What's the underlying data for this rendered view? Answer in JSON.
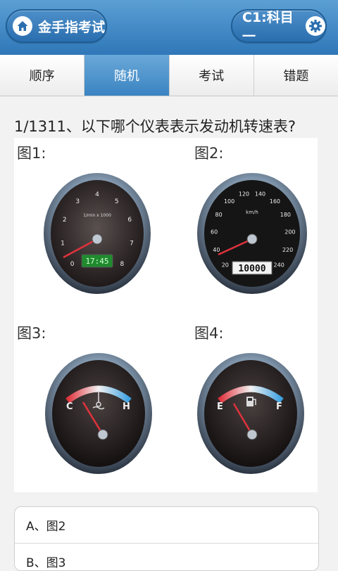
{
  "header": {
    "app_title": "金手指考试",
    "subject": "C1:科目一",
    "home_icon": "home-icon",
    "settings_icon": "gear-icon"
  },
  "tabs": [
    {
      "label": "顺序",
      "active": false
    },
    {
      "label": "随机",
      "active": true
    },
    {
      "label": "考试",
      "active": false
    },
    {
      "label": "错题",
      "active": false
    }
  ],
  "question": {
    "text": "1/1311、以下哪个仪表表示发动机转速表?"
  },
  "figures": {
    "label1": "图1:",
    "label2": "图2:",
    "label3": "图3:",
    "label4": "图4:",
    "tach_unit": "1/min x 1000",
    "tach_ticks": [
      "0",
      "1",
      "2",
      "3",
      "4",
      "5",
      "6",
      "7",
      "8"
    ],
    "clock_display": "17:45",
    "speedo_unit": "km/h",
    "speedo_ticks": [
      "20",
      "40",
      "60",
      "80",
      "100",
      "120",
      "140",
      "160",
      "180",
      "200",
      "220",
      "240"
    ],
    "odometer": "10000",
    "temp_low": "C",
    "temp_high": "H",
    "fuel_low": "E",
    "fuel_high": "F"
  },
  "options": [
    {
      "label": "A、图2"
    },
    {
      "label": "B、图3"
    }
  ],
  "colors": {
    "header_blue": "#3a84c2",
    "active_tab": "#4a90c8",
    "needle_red": "#e0323c",
    "display_green": "#1f8a2e"
  }
}
